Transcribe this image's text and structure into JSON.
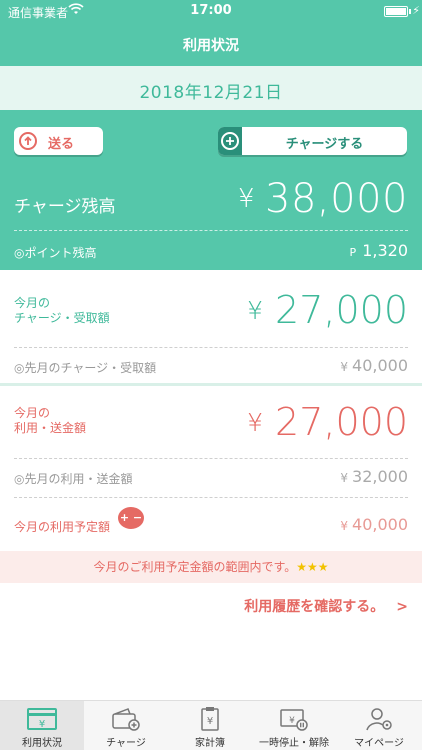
{
  "status_bar": {
    "carrier": "通信事業者",
    "time": "17:00"
  },
  "nav": {
    "title": "利用状況"
  },
  "date": "2018年12月21日",
  "buttons": {
    "send_label": "送る",
    "charge_label": "チャージする"
  },
  "balance": {
    "label": "チャージ残高",
    "currency": "¥",
    "value": "38,000",
    "points_label": "◎ポイント残高",
    "points_prefix": "P",
    "points_value": "1,320"
  },
  "charge_month": {
    "label_line1": "今月の",
    "label_line2": "チャージ・受取額",
    "currency": "¥",
    "value": "27,000",
    "prev_label": "◎先月のチャージ・受取額",
    "prev_currency": "¥",
    "prev_value": "40,000"
  },
  "usage_month": {
    "label_line1": "今月の",
    "label_line2": "利用・送金額",
    "currency": "¥",
    "value": "27,000",
    "prev_label": "◎先月の利用・送金額",
    "prev_currency": "¥",
    "prev_value": "32,000",
    "planned_label": "今月の利用予定額",
    "planned_badge": "+ −",
    "planned_currency": "¥",
    "planned_value": "40,000"
  },
  "notice": {
    "text": "今月のご利用予定金額の範囲内です。",
    "stars": "★★★"
  },
  "history_link": {
    "label": "利用履歴を確認する。",
    "chevron": ">"
  },
  "tabs": [
    {
      "label": "利用状況",
      "icon": "yen-card-icon",
      "active": true
    },
    {
      "label": "チャージ",
      "icon": "wallet-plus-icon",
      "active": false
    },
    {
      "label": "家計簿",
      "icon": "clipboard-yen-icon",
      "active": false
    },
    {
      "label": "一時停止・解除",
      "icon": "card-pause-icon",
      "active": false
    },
    {
      "label": "マイページ",
      "icon": "user-gear-icon",
      "active": false
    }
  ],
  "colors": {
    "primary": "#55c7aa",
    "accent_red": "#e56a64",
    "accent_green": "#3fb99a"
  }
}
